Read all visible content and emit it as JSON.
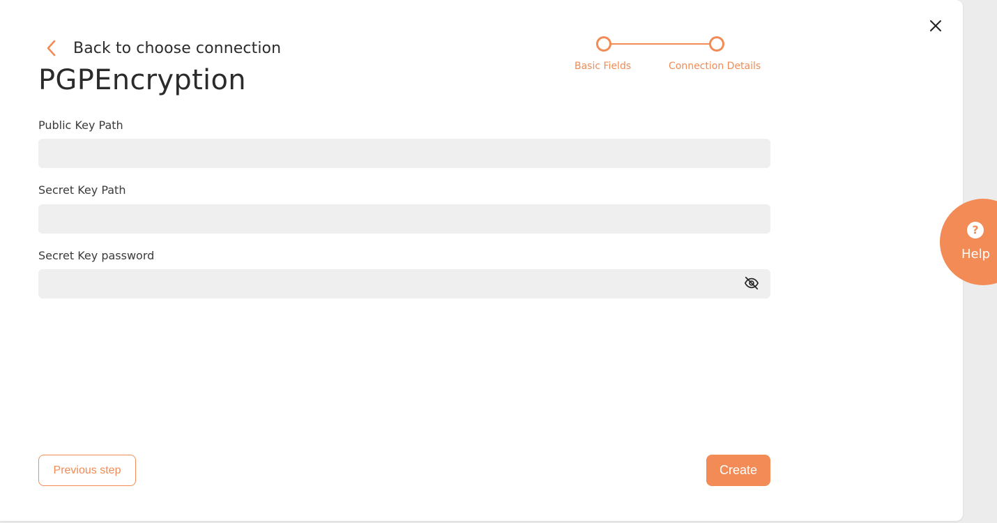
{
  "modal": {
    "back_label": "Back to choose connection",
    "title": "PGPEncryption"
  },
  "stepper": {
    "steps": [
      {
        "label": "Basic Fields"
      },
      {
        "label": "Connection Details"
      }
    ]
  },
  "fields": [
    {
      "label": "Public Key Path",
      "value": "",
      "placeholder": ""
    },
    {
      "label": "Secret Key Path",
      "value": "",
      "placeholder": ""
    },
    {
      "label": "Secret Key password",
      "value": "",
      "placeholder": ""
    }
  ],
  "buttons": {
    "previous": "Previous step",
    "create": "Create"
  },
  "help": {
    "glyph": "?",
    "label": "Help"
  },
  "icons": {
    "back": "chevron-left-icon",
    "close": "close-icon",
    "toggle_password": "eye-off-icon",
    "help": "question-circle-icon"
  },
  "colors": {
    "accent": "#f28b55",
    "input_bg": "#efefef",
    "text": "#2b2b2b"
  }
}
